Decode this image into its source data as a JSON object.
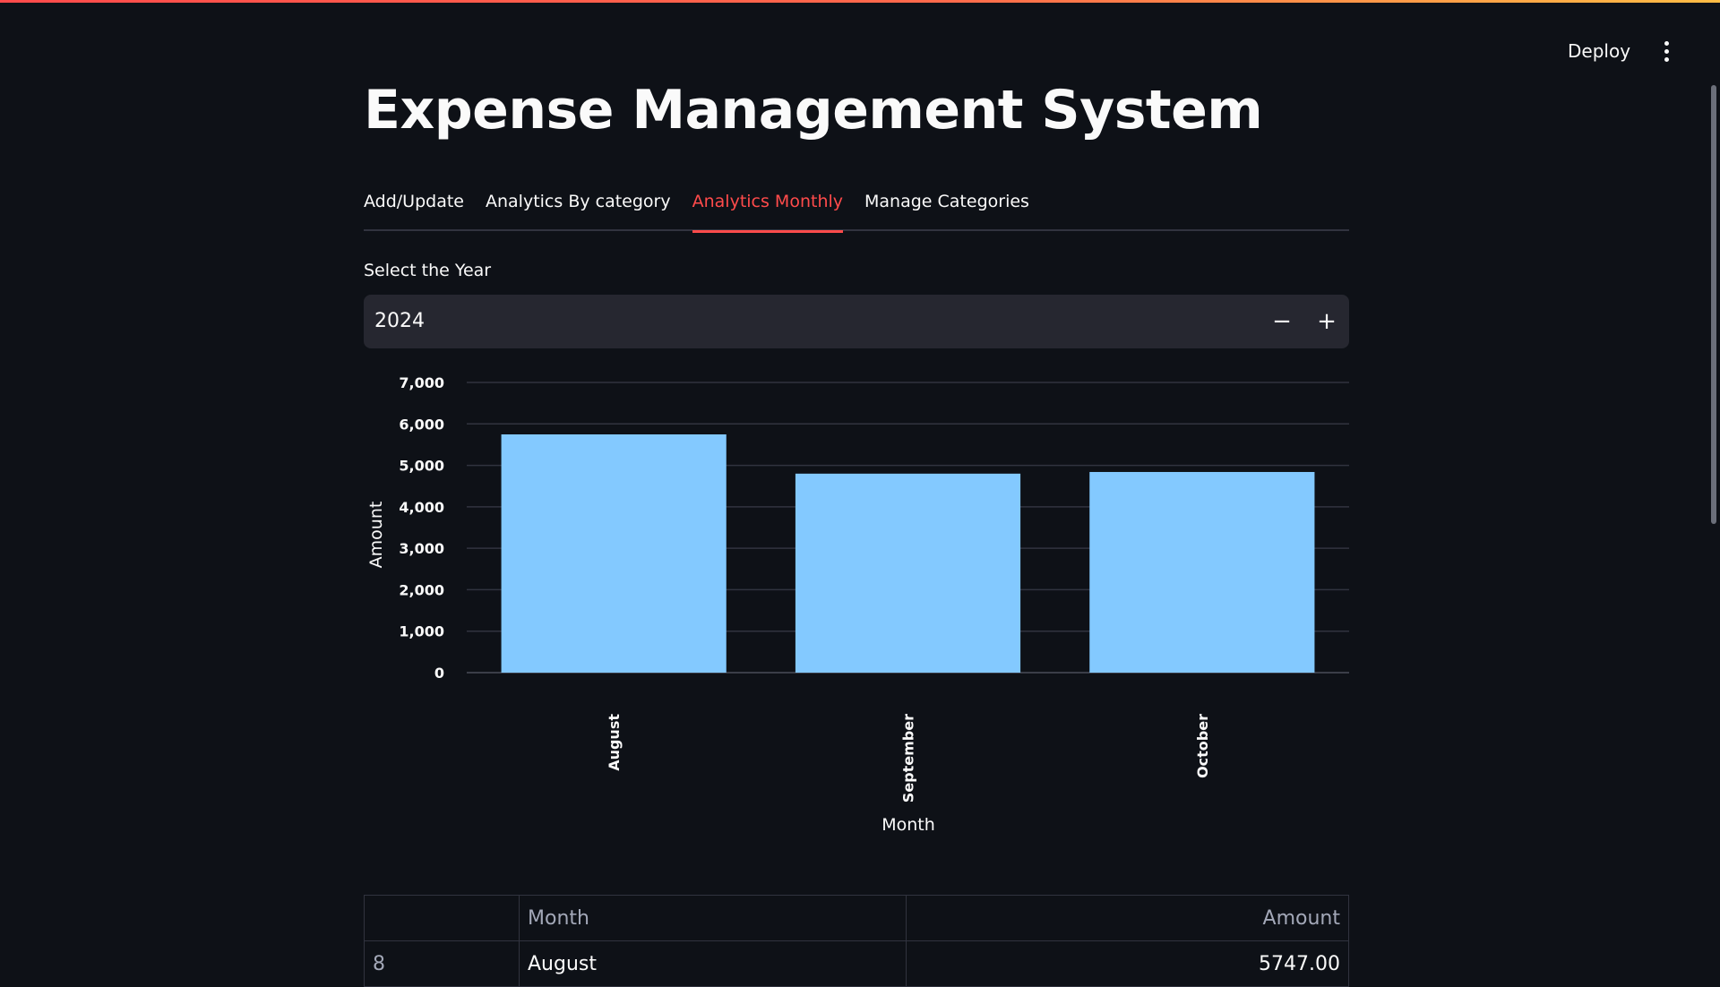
{
  "header": {
    "deploy_label": "Deploy",
    "accent_gradient": [
      "#ff4b4b",
      "#ffbd45"
    ]
  },
  "page": {
    "title": "Expense Management System"
  },
  "tabs": [
    {
      "label": "Add/Update",
      "active": false
    },
    {
      "label": "Analytics By category",
      "active": false
    },
    {
      "label": "Analytics Monthly",
      "active": true
    },
    {
      "label": "Manage Categories",
      "active": false
    }
  ],
  "year_input": {
    "label": "Select the Year",
    "value": "2024",
    "minus_label": "−",
    "plus_label": "+"
  },
  "chart_data": {
    "type": "bar",
    "categories": [
      "August",
      "September",
      "October"
    ],
    "values": [
      5747,
      4800,
      4840
    ],
    "xlabel": "Month",
    "ylabel": "Amount",
    "ylim": [
      0,
      7000
    ],
    "yticks": [
      0,
      1000,
      2000,
      3000,
      4000,
      5000,
      6000,
      7000
    ],
    "ytick_labels": [
      "0",
      "1,000",
      "2,000",
      "3,000",
      "4,000",
      "5,000",
      "6,000",
      "7,000"
    ],
    "bar_color": "#83c9ff",
    "grid": true
  },
  "table": {
    "columns": [
      "",
      "Month",
      "Amount"
    ],
    "rows": [
      {
        "index": "8",
        "month": "August",
        "amount": "5747.00"
      }
    ]
  }
}
